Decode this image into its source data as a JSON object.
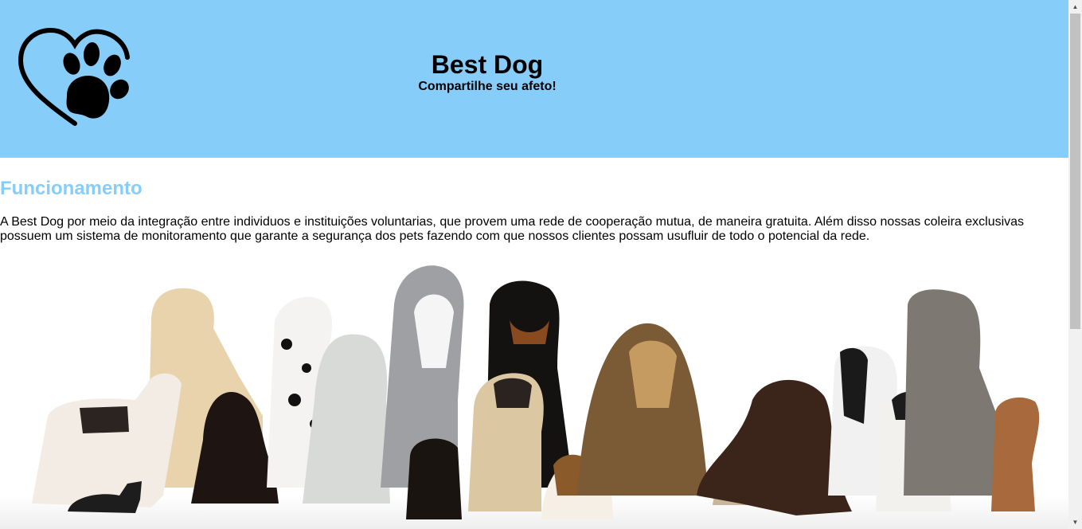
{
  "header": {
    "logo_icon": "heart-paw-icon",
    "title": "Best Dog",
    "tagline": "Compartilhe seu afeto!",
    "background_color": "#87cdf9"
  },
  "main": {
    "section_title": "Funcionamento",
    "section_title_color": "#87cdf9",
    "description": "A Best Dog por meio da integração entre individuos e instituições voluntarias, que provem uma rede de cooperação mutua, de maneira gratuita. Além disso nossas coleira exclusivas possuem um sistema de monitoramento que garante a segurança dos pets fazendo com que nossos clientes possam usufluir de todo o potencial da rede.",
    "image_icon": "dogs-group-photo"
  },
  "scrollbar": {
    "up_icon": "scroll-up-arrow-icon",
    "down_icon": "scroll-down-arrow-icon"
  }
}
